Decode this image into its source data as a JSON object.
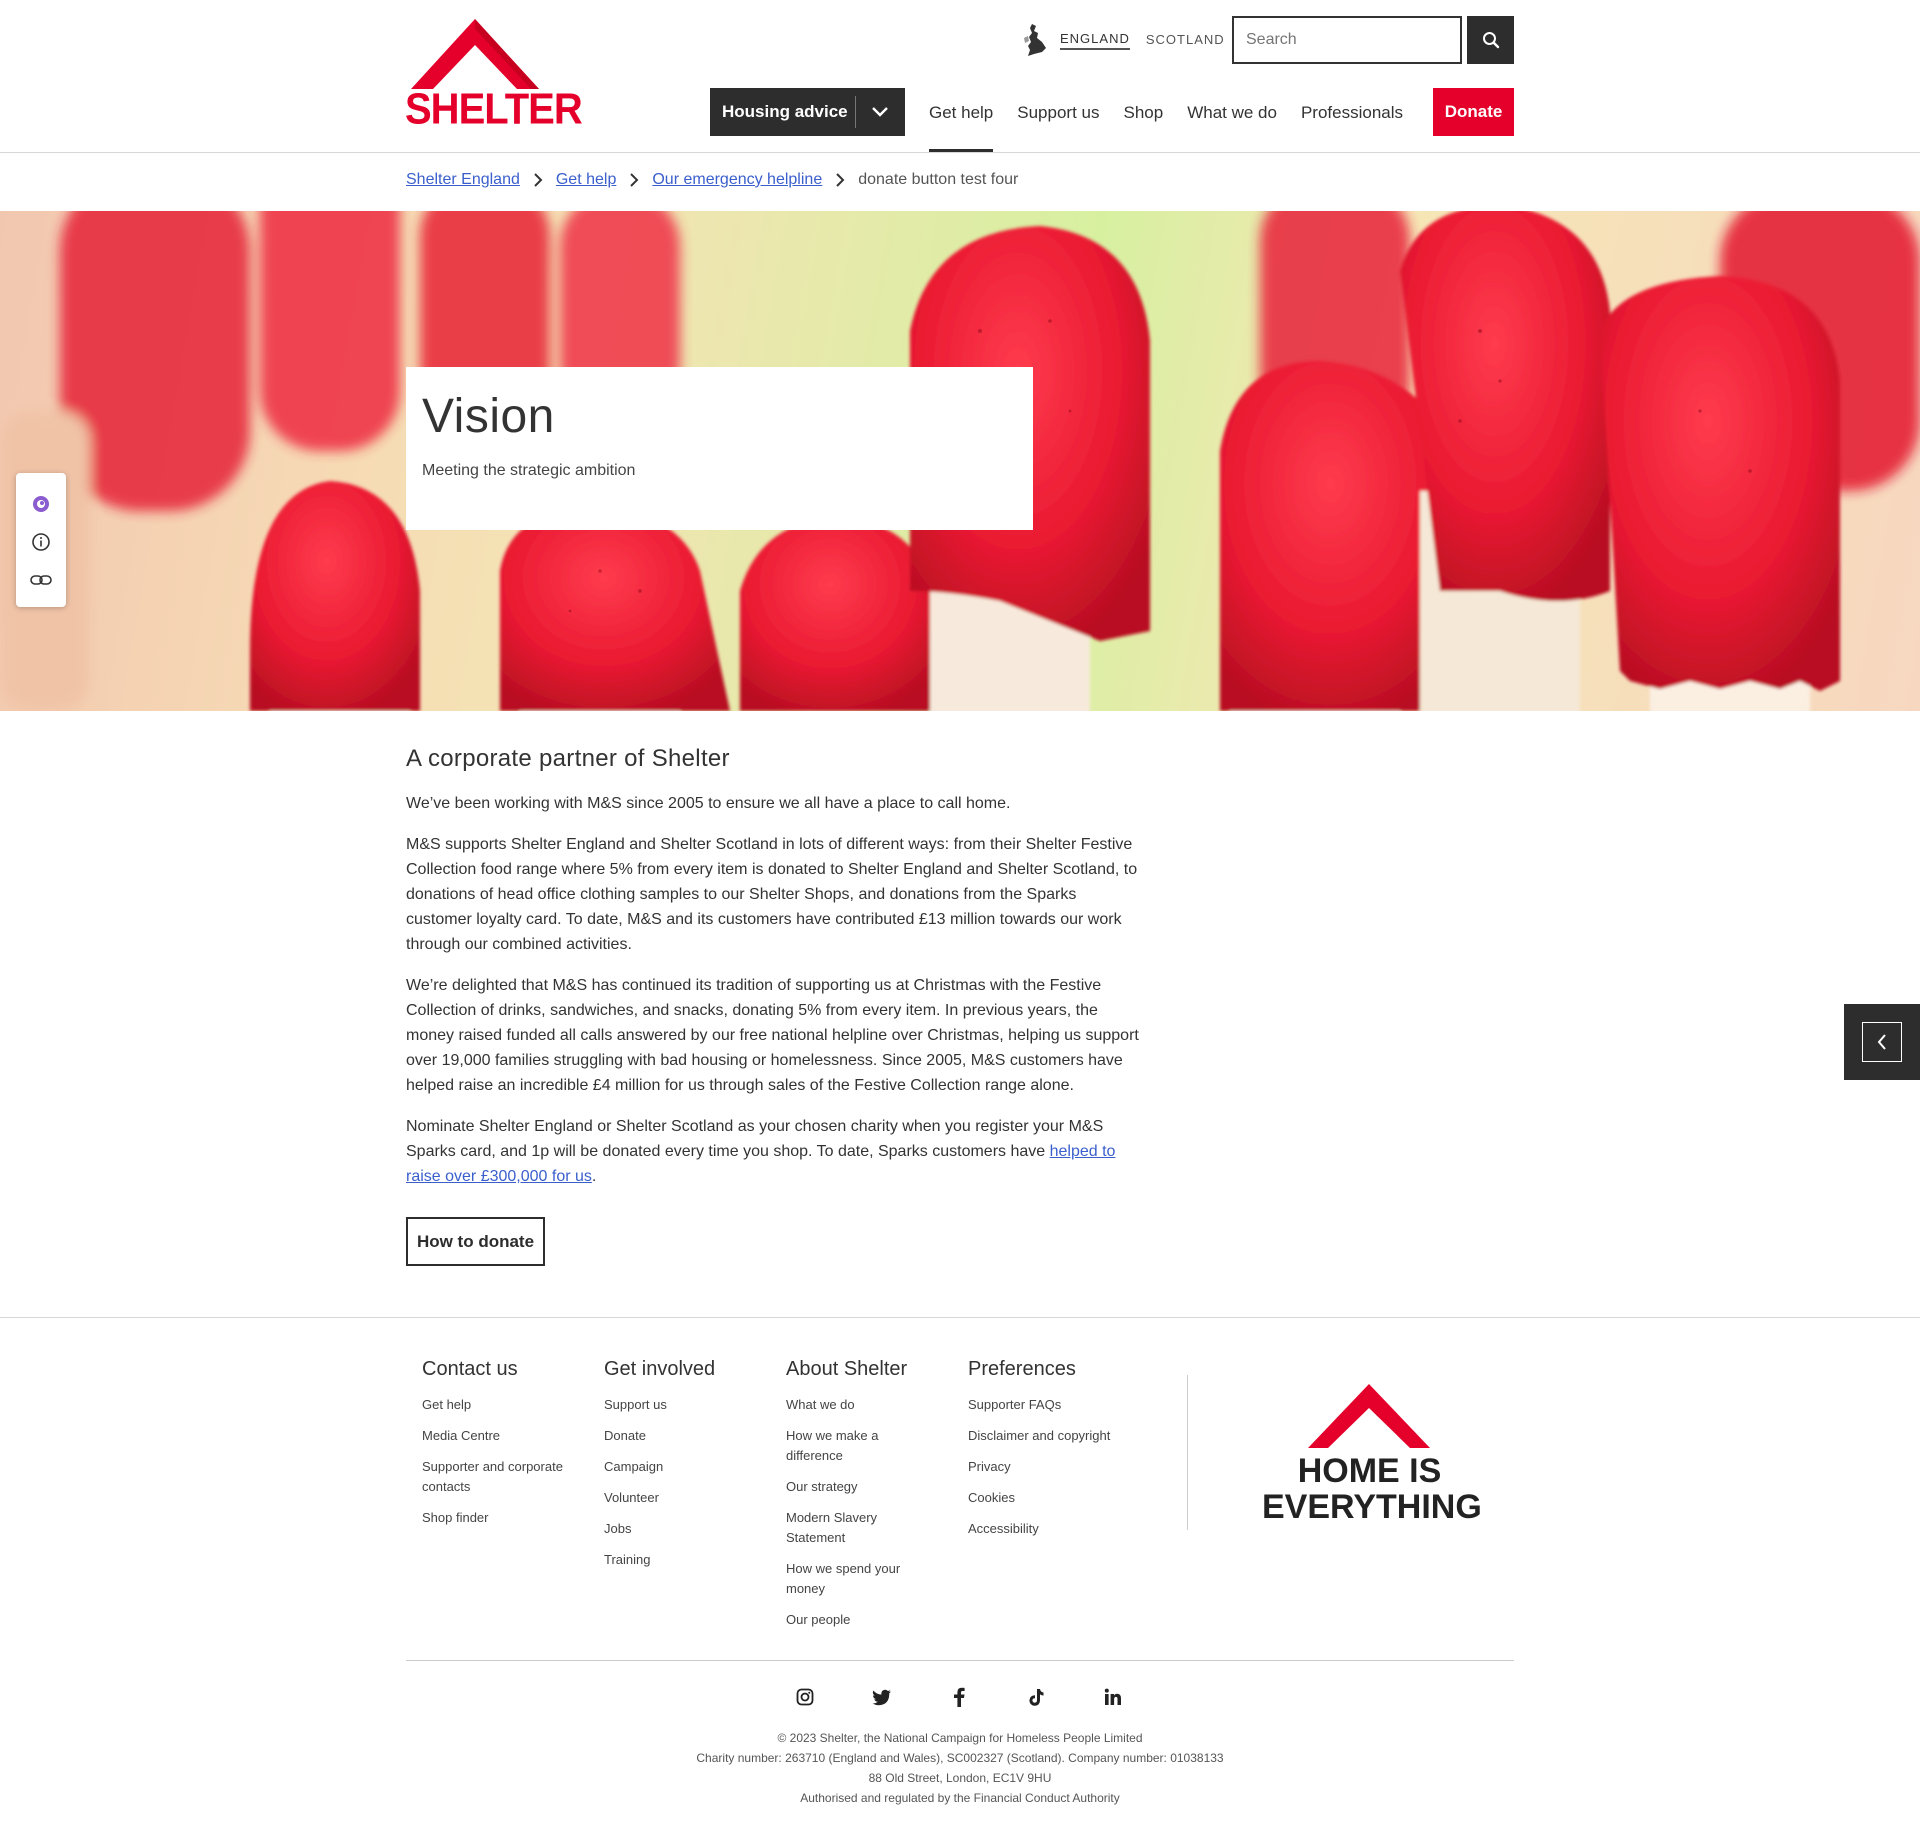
{
  "header": {
    "logo_text": "SHELTER",
    "regions": [
      "ENGLAND",
      "SCOTLAND"
    ],
    "search_placeholder": "Search",
    "housing_advice": "Housing advice",
    "nav": [
      "Get help",
      "Support us",
      "Shop",
      "What we do",
      "Professionals"
    ],
    "donate": "Donate"
  },
  "breadcrumb": {
    "links": [
      "Shelter England",
      "Get help",
      "Our emergency helpline"
    ],
    "current": "donate button test four"
  },
  "hero": {
    "title": "Vision",
    "subtitle": "Meeting the strategic ambition"
  },
  "main": {
    "heading": "A corporate partner of Shelter",
    "p1": "We’ve been working with M&S since 2005 to ensure we all have a place to call home.",
    "p2": "M&S supports Shelter England and Shelter Scotland in lots of different ways: from their Shelter Festive Collection food range where 5% from every item is donated to Shelter England and Shelter Scotland, to donations of head office clothing samples to our Shelter Shops, and donations from the Sparks customer loyalty card. To date, M&S and its customers have contributed £13 million towards our work through our combined activities.",
    "p3": "We’re delighted that M&S has continued its tradition of supporting us at Christmas with the Festive Collection of drinks, sandwiches, and snacks, donating 5% from every item. In previous years, the money raised funded all calls answered by our free national helpline over Christmas, helping us support over 19,000 families struggling with bad housing or homelessness. Since 2005, M&S customers have helped raise an incredible £4 million for us through sales of the Festive Collection range alone.",
    "p4_prefix": "Nominate Shelter England or Shelter Scotland as your chosen charity when you register your M&S Sparks card, and 1p will be donated every time you shop. To date, Sparks customers have ",
    "p4_link": "helped to raise over £300,000 for us",
    "p4_suffix": ".",
    "cta": "How to donate"
  },
  "footer": {
    "columns": [
      {
        "title": "Contact us",
        "links": [
          "Get help",
          "Media Centre",
          "Supporter and corporate contacts",
          "Shop finder"
        ]
      },
      {
        "title": "Get involved",
        "links": [
          "Support us",
          "Donate",
          "Campaign",
          "Volunteer",
          "Jobs",
          "Training"
        ]
      },
      {
        "title": "About Shelter",
        "links": [
          "What we do",
          "How we make a difference",
          "Our strategy",
          "Modern Slavery Statement",
          "How we spend your money",
          "Our people"
        ]
      },
      {
        "title": "Preferences",
        "links": [
          "Supporter FAQs",
          "Disclaimer and copyright",
          "Privacy",
          "Cookies",
          "Accessibility"
        ]
      }
    ],
    "home_logo": [
      "HOME IS",
      "EVERYTHING"
    ],
    "social": [
      "instagram-icon",
      "twitter-icon",
      "facebook-icon",
      "tiktok-icon",
      "linkedin-icon"
    ],
    "legal": [
      "© 2023 Shelter, the National Campaign for Homeless People Limited",
      "Charity number: 263710 (England and Wales), SC002327 (Scotland). Company number: 01038133",
      "88 Old Street, London, EC1V 9HU",
      "Authorised and regulated by the Financial Conduct Authority"
    ]
  },
  "colors": {
    "brand_red": "#e4002b",
    "dark": "#2d2d2d",
    "link": "#3a5fcd"
  }
}
